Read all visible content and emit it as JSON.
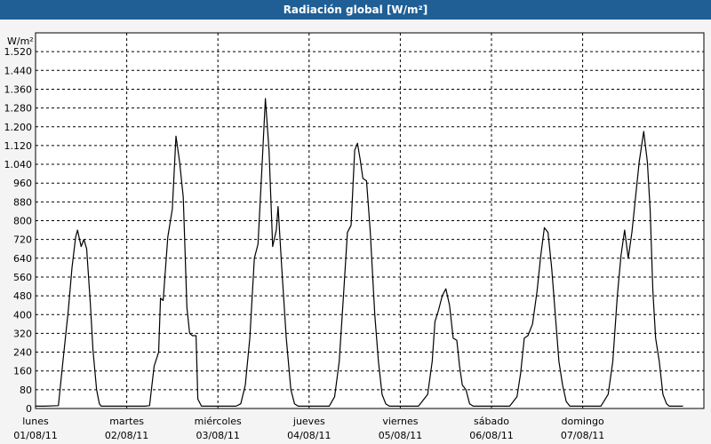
{
  "window": {
    "title": "Radiación global [W/m²]"
  },
  "chart_data": {
    "type": "line",
    "title": "Radiación global [W/m²]",
    "ylabel": "W/m²",
    "xlabel": "",
    "ylim": [
      0,
      1600
    ],
    "xlim": [
      0,
      7.5
    ],
    "grid": true,
    "yticks": [
      0,
      80,
      160,
      240,
      320,
      400,
      480,
      560,
      640,
      720,
      800,
      880,
      960,
      1040,
      1120,
      1200,
      1280,
      1360,
      1440,
      1520
    ],
    "ytick_labels": [
      "0",
      "80",
      "160",
      "240",
      "320",
      "400",
      "480",
      "560",
      "640",
      "720",
      "800",
      "880",
      "960",
      "1.040",
      "1.120",
      "1.200",
      "1.280",
      "1.360",
      "1.440",
      "1.520"
    ],
    "x_ticks": [
      {
        "x": 0,
        "day": "lunes",
        "date": "01/08/11"
      },
      {
        "x": 1,
        "day": "martes",
        "date": "02/08/11"
      },
      {
        "x": 2,
        "day": "miércoles",
        "date": "03/08/11"
      },
      {
        "x": 3,
        "day": "jueves",
        "date": "04/08/11"
      },
      {
        "x": 4,
        "day": "viernes",
        "date": "05/08/11"
      },
      {
        "x": 5,
        "day": "sábado",
        "date": "06/08/11"
      },
      {
        "x": 6,
        "day": "domingo",
        "date": "07/08/11"
      }
    ],
    "series": [
      {
        "color": "#000000",
        "points": [
          [
            0,
            10
          ],
          [
            0.1,
            10
          ],
          [
            0.25,
            12
          ],
          [
            0.3,
            200
          ],
          [
            0.36,
            420
          ],
          [
            0.4,
            600
          ],
          [
            0.44,
            730
          ],
          [
            0.46,
            760
          ],
          [
            0.5,
            690
          ],
          [
            0.53,
            720
          ],
          [
            0.56,
            680
          ],
          [
            0.6,
            450
          ],
          [
            0.63,
            250
          ],
          [
            0.67,
            80
          ],
          [
            0.7,
            20
          ],
          [
            0.72,
            10
          ],
          [
            1.0,
            10
          ],
          [
            1.2,
            10
          ],
          [
            1.25,
            12
          ],
          [
            1.3,
            180
          ],
          [
            1.35,
            240
          ],
          [
            1.37,
            470
          ],
          [
            1.4,
            460
          ],
          [
            1.45,
            730
          ],
          [
            1.5,
            850
          ],
          [
            1.54,
            1160
          ],
          [
            1.58,
            1050
          ],
          [
            1.62,
            900
          ],
          [
            1.66,
            430
          ],
          [
            1.69,
            320
          ],
          [
            1.72,
            310
          ],
          [
            1.76,
            310
          ],
          [
            1.78,
            40
          ],
          [
            1.82,
            10
          ],
          [
            2.0,
            10
          ],
          [
            2.2,
            10
          ],
          [
            2.25,
            20
          ],
          [
            2.3,
            100
          ],
          [
            2.35,
            300
          ],
          [
            2.4,
            640
          ],
          [
            2.44,
            700
          ],
          [
            2.48,
            1000
          ],
          [
            2.52,
            1320
          ],
          [
            2.56,
            1100
          ],
          [
            2.6,
            690
          ],
          [
            2.64,
            760
          ],
          [
            2.66,
            860
          ],
          [
            2.7,
            600
          ],
          [
            2.75,
            300
          ],
          [
            2.8,
            80
          ],
          [
            2.84,
            20
          ],
          [
            2.88,
            10
          ],
          [
            3.0,
            10
          ],
          [
            3.22,
            10
          ],
          [
            3.28,
            50
          ],
          [
            3.33,
            200
          ],
          [
            3.38,
            500
          ],
          [
            3.42,
            750
          ],
          [
            3.46,
            780
          ],
          [
            3.5,
            1100
          ],
          [
            3.53,
            1130
          ],
          [
            3.56,
            1060
          ],
          [
            3.59,
            980
          ],
          [
            3.63,
            970
          ],
          [
            3.67,
            760
          ],
          [
            3.72,
            400
          ],
          [
            3.76,
            200
          ],
          [
            3.8,
            60
          ],
          [
            3.84,
            20
          ],
          [
            3.88,
            10
          ],
          [
            4.0,
            10
          ],
          [
            4.2,
            10
          ],
          [
            4.3,
            60
          ],
          [
            4.35,
            200
          ],
          [
            4.38,
            370
          ],
          [
            4.42,
            420
          ],
          [
            4.46,
            480
          ],
          [
            4.5,
            510
          ],
          [
            4.54,
            440
          ],
          [
            4.58,
            300
          ],
          [
            4.62,
            290
          ],
          [
            4.65,
            180
          ],
          [
            4.68,
            100
          ],
          [
            4.72,
            80
          ],
          [
            4.76,
            20
          ],
          [
            4.8,
            10
          ],
          [
            5.0,
            10
          ],
          [
            5.2,
            10
          ],
          [
            5.28,
            50
          ],
          [
            5.32,
            150
          ],
          [
            5.36,
            300
          ],
          [
            5.4,
            310
          ],
          [
            5.45,
            360
          ],
          [
            5.5,
            500
          ],
          [
            5.54,
            650
          ],
          [
            5.58,
            770
          ],
          [
            5.62,
            750
          ],
          [
            5.66,
            600
          ],
          [
            5.7,
            400
          ],
          [
            5.74,
            200
          ],
          [
            5.78,
            100
          ],
          [
            5.82,
            30
          ],
          [
            5.86,
            10
          ],
          [
            6.0,
            10
          ],
          [
            6.2,
            10
          ],
          [
            6.28,
            60
          ],
          [
            6.33,
            200
          ],
          [
            6.38,
            480
          ],
          [
            6.42,
            650
          ],
          [
            6.46,
            760
          ],
          [
            6.5,
            640
          ],
          [
            6.54,
            750
          ],
          [
            6.58,
            900
          ],
          [
            6.62,
            1050
          ],
          [
            6.67,
            1180
          ],
          [
            6.71,
            1050
          ],
          [
            6.74,
            850
          ],
          [
            6.77,
            500
          ],
          [
            6.8,
            300
          ],
          [
            6.84,
            200
          ],
          [
            6.88,
            60
          ],
          [
            6.92,
            20
          ],
          [
            6.95,
            10
          ],
          [
            7.1,
            10
          ]
        ]
      }
    ]
  }
}
